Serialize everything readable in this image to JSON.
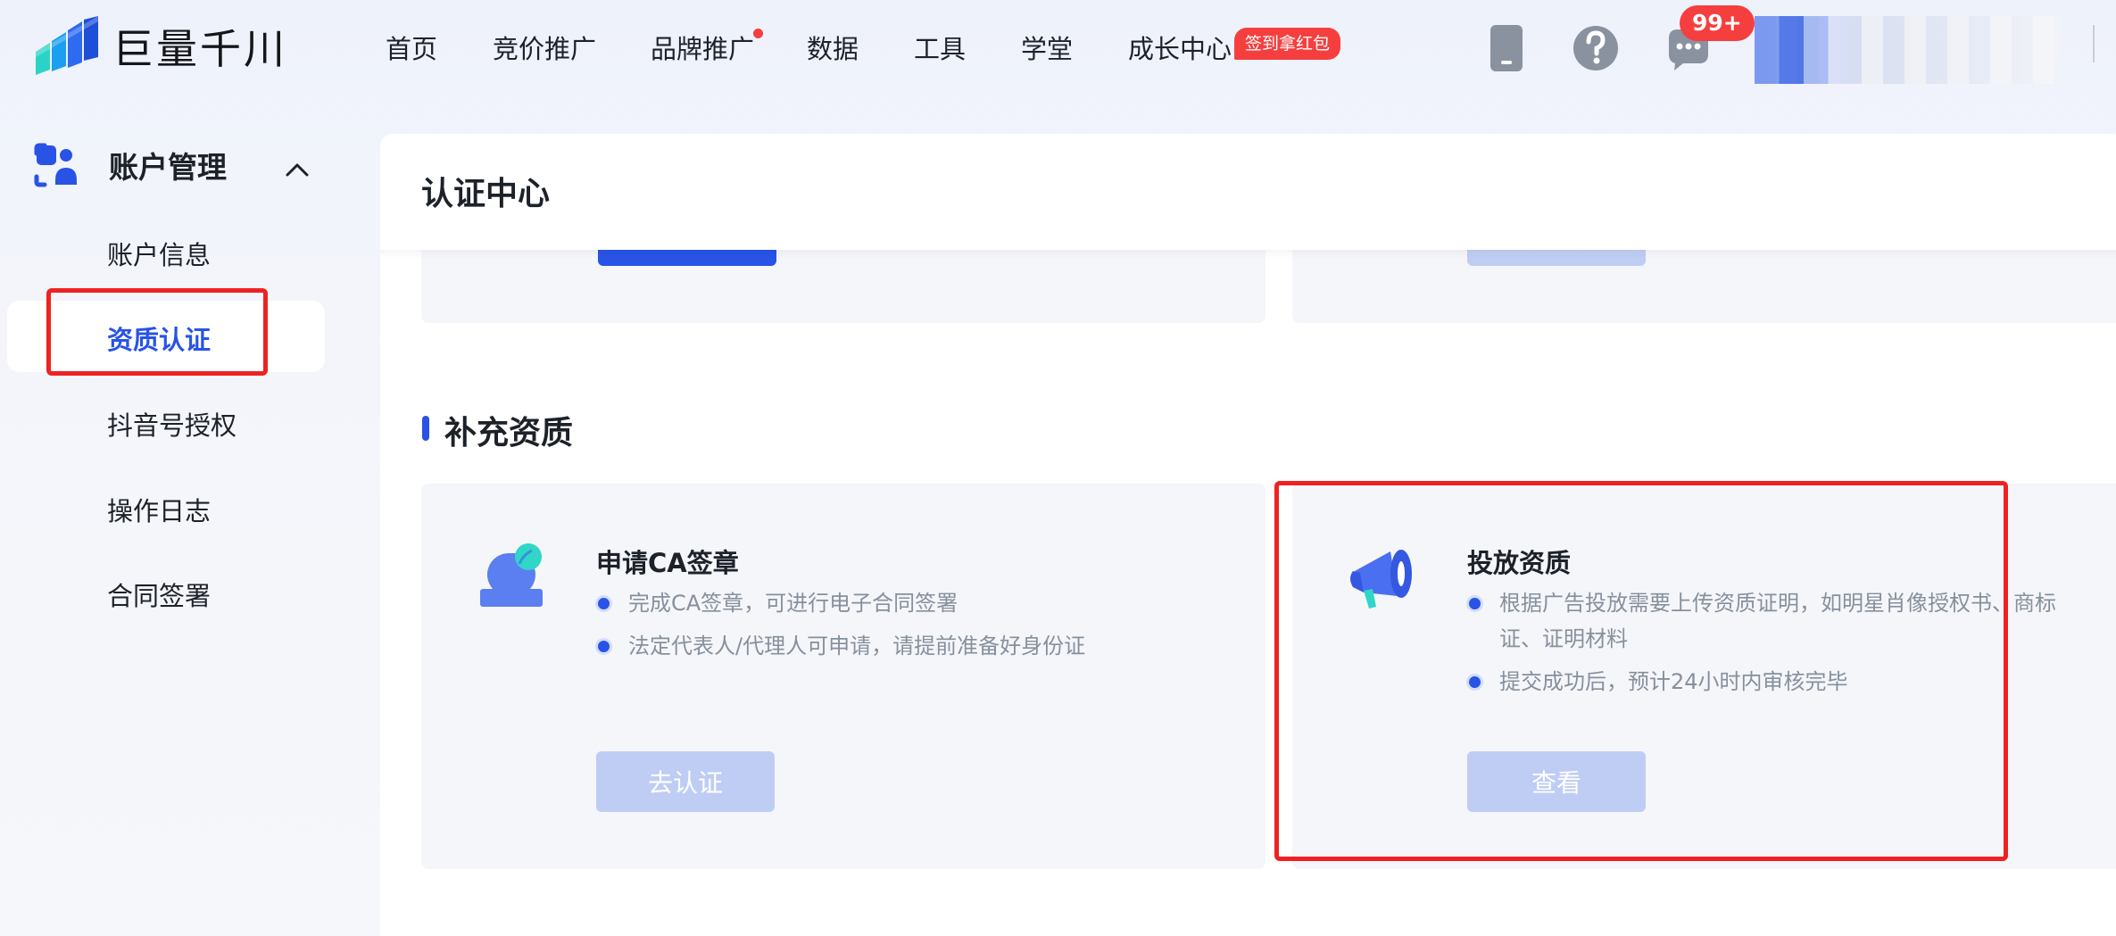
{
  "brand": {
    "name": "巨量千川"
  },
  "nav": {
    "items": [
      {
        "label": "首页"
      },
      {
        "label": "竞价推广"
      },
      {
        "label": "品牌推广",
        "has_dot": true
      },
      {
        "label": "数据"
      },
      {
        "label": "工具"
      },
      {
        "label": "学堂"
      },
      {
        "label": "成长中心"
      }
    ],
    "promo_badge": "签到拿红包",
    "icons": [
      "mobile-icon",
      "help-icon",
      "message-icon"
    ],
    "message_count": "99+"
  },
  "sidebar": {
    "group_label": "账户管理",
    "expanded": true,
    "items": [
      {
        "label": "账户信息",
        "active": false
      },
      {
        "label": "资质认证",
        "active": true
      },
      {
        "label": "抖音号授权",
        "active": false
      },
      {
        "label": "操作日志",
        "active": false
      },
      {
        "label": "合同签署",
        "active": false
      }
    ]
  },
  "main": {
    "title": "认证中心",
    "section_title": "补充资质",
    "cards": [
      {
        "title": "申请CA签章",
        "bullets": [
          "完成CA签章，可进行电子合同签署",
          "法定代表人/代理人可申请，请提前准备好身份证"
        ],
        "button_label": "去认证",
        "icon": "seal-icon"
      },
      {
        "title": "投放资质",
        "bullets": [
          "根据广告投放需要上传资质证明，如明星肖像授权书、商标证、证明材料",
          "提交成功后，预计24小时内审核完毕"
        ],
        "button_label": "查看",
        "icon": "megaphone-icon"
      }
    ]
  },
  "colors": {
    "primary": "#2853e6",
    "disabled_button": "#bfcdf5",
    "highlight_box": "#ee2222",
    "badge_red": "#f53f3f",
    "card_bg": "#f5f6fa"
  }
}
